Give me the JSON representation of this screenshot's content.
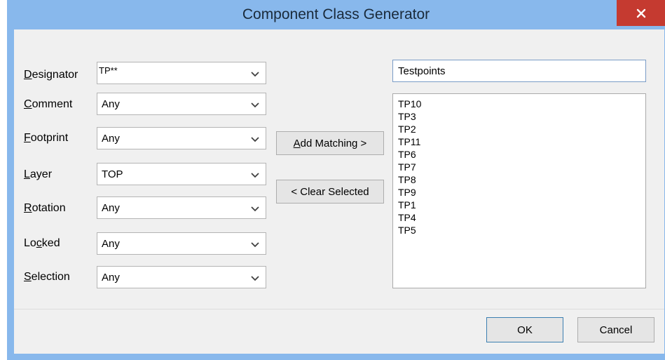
{
  "window": {
    "title": "Component Class Generator",
    "close_glyph": "×"
  },
  "filters": [
    {
      "label_pre": "",
      "label_ul": "D",
      "label_post": "esignator",
      "value": "TP**"
    },
    {
      "label_pre": "",
      "label_ul": "C",
      "label_post": "omment",
      "value": "Any"
    },
    {
      "label_pre": "",
      "label_ul": "F",
      "label_post": "ootprint",
      "value": "Any"
    },
    {
      "label_pre": "",
      "label_ul": "L",
      "label_post": "ayer",
      "value": "TOP"
    },
    {
      "label_pre": "",
      "label_ul": "R",
      "label_post": "otation",
      "value": "Any"
    },
    {
      "label_pre": "Lo",
      "label_ul": "c",
      "label_post": "ked",
      "value": "Any"
    },
    {
      "label_pre": "",
      "label_ul": "S",
      "label_post": "election",
      "value": "Any"
    }
  ],
  "actions": {
    "add_matching_ul": "A",
    "add_matching_rest": "dd Matching >",
    "clear_selected": "< Clear Selected"
  },
  "class_name": "Testpoints",
  "members": [
    "TP10",
    "TP3",
    "TP2",
    "TP11",
    "TP6",
    "TP7",
    "TP8",
    "TP9",
    "TP1",
    "TP4",
    "TP5"
  ],
  "footer": {
    "ok": "OK",
    "cancel": "Cancel"
  },
  "icons": {
    "close": "close-icon",
    "dropdown": "chevron-down-icon"
  },
  "colors": {
    "frame": "#88b8ec",
    "close_button": "#c53a30",
    "body": "#f0f0f0"
  }
}
